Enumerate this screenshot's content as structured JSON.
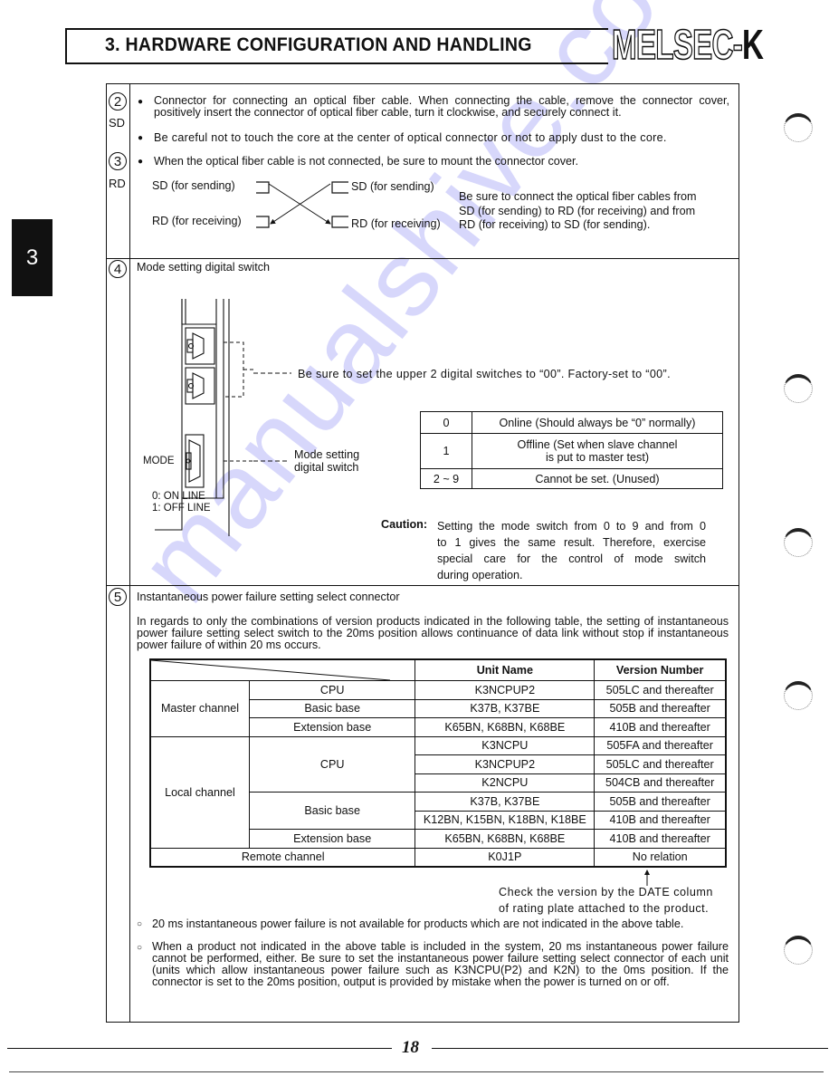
{
  "header": {
    "title": "3. HARDWARE CONFIGURATION AND HANDLING",
    "brand_outline": "MELSEC-",
    "brand_solid": "K"
  },
  "chapter_tab": "3",
  "sections": {
    "s2": {
      "number": "2",
      "tag": "SD",
      "bullets": [
        "Connector for connecting an optical fiber cable. When connecting the cable, remove the connector cover, positively insert the connector of optical fiber cable, turn it clockwise, and securely connect it.",
        "Be careful not to touch the core at the center of optical connector or not to apply dust to the core."
      ]
    },
    "s3": {
      "number": "3",
      "tag": "RD",
      "bullet": "When the optical fiber cable is not connected, be sure to mount the connector cover.",
      "diagram": {
        "left_top": "SD (for sending)",
        "left_bottom": "RD (for receiving)",
        "right_top": "SD (for sending)",
        "right_bottom": "RD (for receiving)"
      },
      "note_lines": [
        "Be sure to connect the optical fiber cables from",
        "SD (for sending) to RD (for receiving) and from",
        "RD (for receiving) to SD (for sending)."
      ]
    },
    "s4": {
      "number": "4",
      "title": "Mode setting digital switch",
      "upper_note": "Be sure to set the upper 2 digital switches to “00”. Factory-set to “00”.",
      "mode_label": "MODE",
      "switch_label_1": "Mode setting",
      "switch_label_2": "digital switch",
      "legend_1": "0: ON LINE",
      "legend_2": "1: OFF LINE",
      "mode_table": [
        {
          "value": "0",
          "desc": "Online (Should always be “0” normally)"
        },
        {
          "value": "1",
          "desc": "Offline (Set when slave channel",
          "desc2": "is put to master test)"
        },
        {
          "value": "2 ~ 9",
          "desc": "Cannot be set. (Unused)"
        }
      ],
      "caution_label": "Caution:",
      "caution_lines": [
        "Setting the mode switch from 0 to 9 and from 0",
        "to 1 gives the same result. Therefore, exercise",
        "special care for the control of mode switch",
        "during operation."
      ]
    },
    "s5": {
      "number": "5",
      "title": "Instantaneous power failure setting select connector",
      "intro": "In regards to only the combinations of version products indicated in the following table, the setting of instantaneous power failure setting select switch to the 20ms position allows continuance of data link without stop if instantaneous power failure of within 20 ms occurs.",
      "table": {
        "headers": [
          "Unit Name",
          "Version Number"
        ],
        "groups": {
          "master": "Master channel",
          "local": "Local channel",
          "remote": "Remote channel"
        },
        "categories": {
          "cpu": "CPU",
          "basic": "Basic base",
          "ext": "Extension base"
        },
        "rows": [
          {
            "unit": "K3NCPUP2",
            "version": "505LC and thereafter"
          },
          {
            "unit": "K37B, K37BE",
            "version": "505B and thereafter"
          },
          {
            "unit": "K65BN, K68BN, K68BE",
            "version": "410B and thereafter"
          },
          {
            "unit": "K3NCPU",
            "version": "505FA and thereafter"
          },
          {
            "unit": "K3NCPUP2",
            "version": "505LC and thereafter"
          },
          {
            "unit": "K2NCPU",
            "version": "504CB and thereafter"
          },
          {
            "unit": "K37B, K37BE",
            "version": "505B and thereafter"
          },
          {
            "unit": "K12BN, K15BN, K18BN, K18BE",
            "version": "410B and thereafter"
          },
          {
            "unit": "K65BN, K68BN, K68BE",
            "version": "410B and thereafter"
          },
          {
            "unit": "K0J1P",
            "version": "No relation"
          }
        ]
      },
      "check_note_1": "Check the version by the DATE column",
      "check_note_2": "of rating plate attached to the product.",
      "notes": [
        "20 ms instantaneous power failure is not available for products which are not indicated in the above table.",
        "When a product not indicated in the above table is included in the system, 20 ms instantaneous power failure cannot be performed, either. Be sure to set the instantaneous power failure setting select connector of each unit (units which allow instantaneous power failure such as K3NCPU(P2) and K2N) to the 0ms position. If the connector is set to the 20ms position, output is provided by mistake when the power is turned on or off."
      ]
    }
  },
  "page_number": "18",
  "watermark": "manualshive.com"
}
